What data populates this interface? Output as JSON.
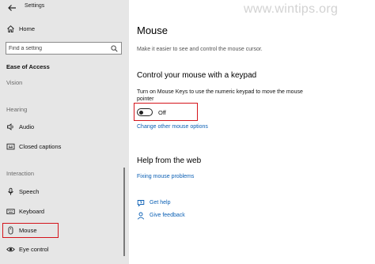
{
  "window": {
    "title": "Settings"
  },
  "watermark": {
    "text": "www.wintips.org"
  },
  "sidebar": {
    "home_label": "Home",
    "search_placeholder": "Find a setting",
    "category": "Ease of Access",
    "groups": {
      "vision": "Vision",
      "hearing": "Hearing",
      "interaction": "Interaction"
    },
    "items": {
      "audio": "Audio",
      "closed_captions": "Closed captions",
      "speech": "Speech",
      "keyboard": "Keyboard",
      "mouse": "Mouse",
      "eye_control": "Eye control"
    },
    "selected_item": "Mouse"
  },
  "main": {
    "title": "Mouse",
    "subtitle": "Make it easier to see and control the mouse cursor.",
    "section_keypad": {
      "heading": "Control your mouse with a keypad",
      "description": "Turn on Mouse Keys to use the numeric keypad to move the mouse pointer",
      "toggle_state": "Off",
      "toggle_on": false,
      "link": "Change other mouse options"
    },
    "section_help": {
      "heading": "Help from the web",
      "link": "Fixing mouse problems"
    },
    "get_help": "Get help",
    "give_feedback": "Give feedback"
  },
  "colors": {
    "sidebar_bg": "#e6e6e6",
    "link": "#0a5fb4",
    "annotation": "#d4141b"
  }
}
